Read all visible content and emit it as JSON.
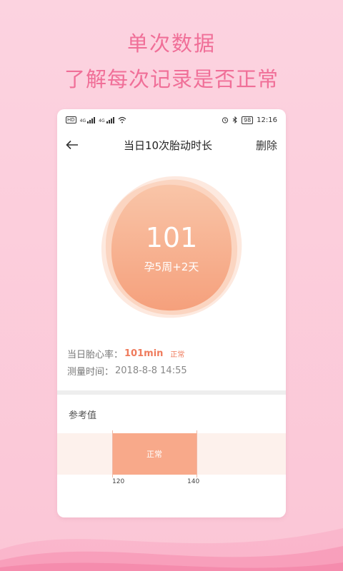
{
  "promo": {
    "title": "单次数据",
    "subtitle": "了解每次记录是否正常"
  },
  "status_bar": {
    "hd": "HD",
    "net1": "4G",
    "net2": "4G",
    "battery": "98",
    "time": "12:16",
    "icons": [
      "signal-icon",
      "wifi-icon",
      "alarm-icon",
      "bluetooth-icon",
      "battery-icon"
    ]
  },
  "nav": {
    "title": "当日10次胎动时长",
    "delete_label": "删除"
  },
  "summary": {
    "value": "101",
    "pregnancy_week": "孕5周+2天"
  },
  "info": {
    "heart_rate_label": "当日胎心率：",
    "heart_rate_value": "101min",
    "heart_rate_status": "正常",
    "time_label": "测量时间：",
    "time_value": "2018-8-8  14:55"
  },
  "reference": {
    "label": "参考值",
    "normal_label": "正常",
    "low": "120",
    "high": "140"
  },
  "colors": {
    "accent": "#ef7b5c",
    "promo_text": "#f06f98",
    "normal_band": "#f8a98a",
    "background": "#fbc6d6"
  }
}
